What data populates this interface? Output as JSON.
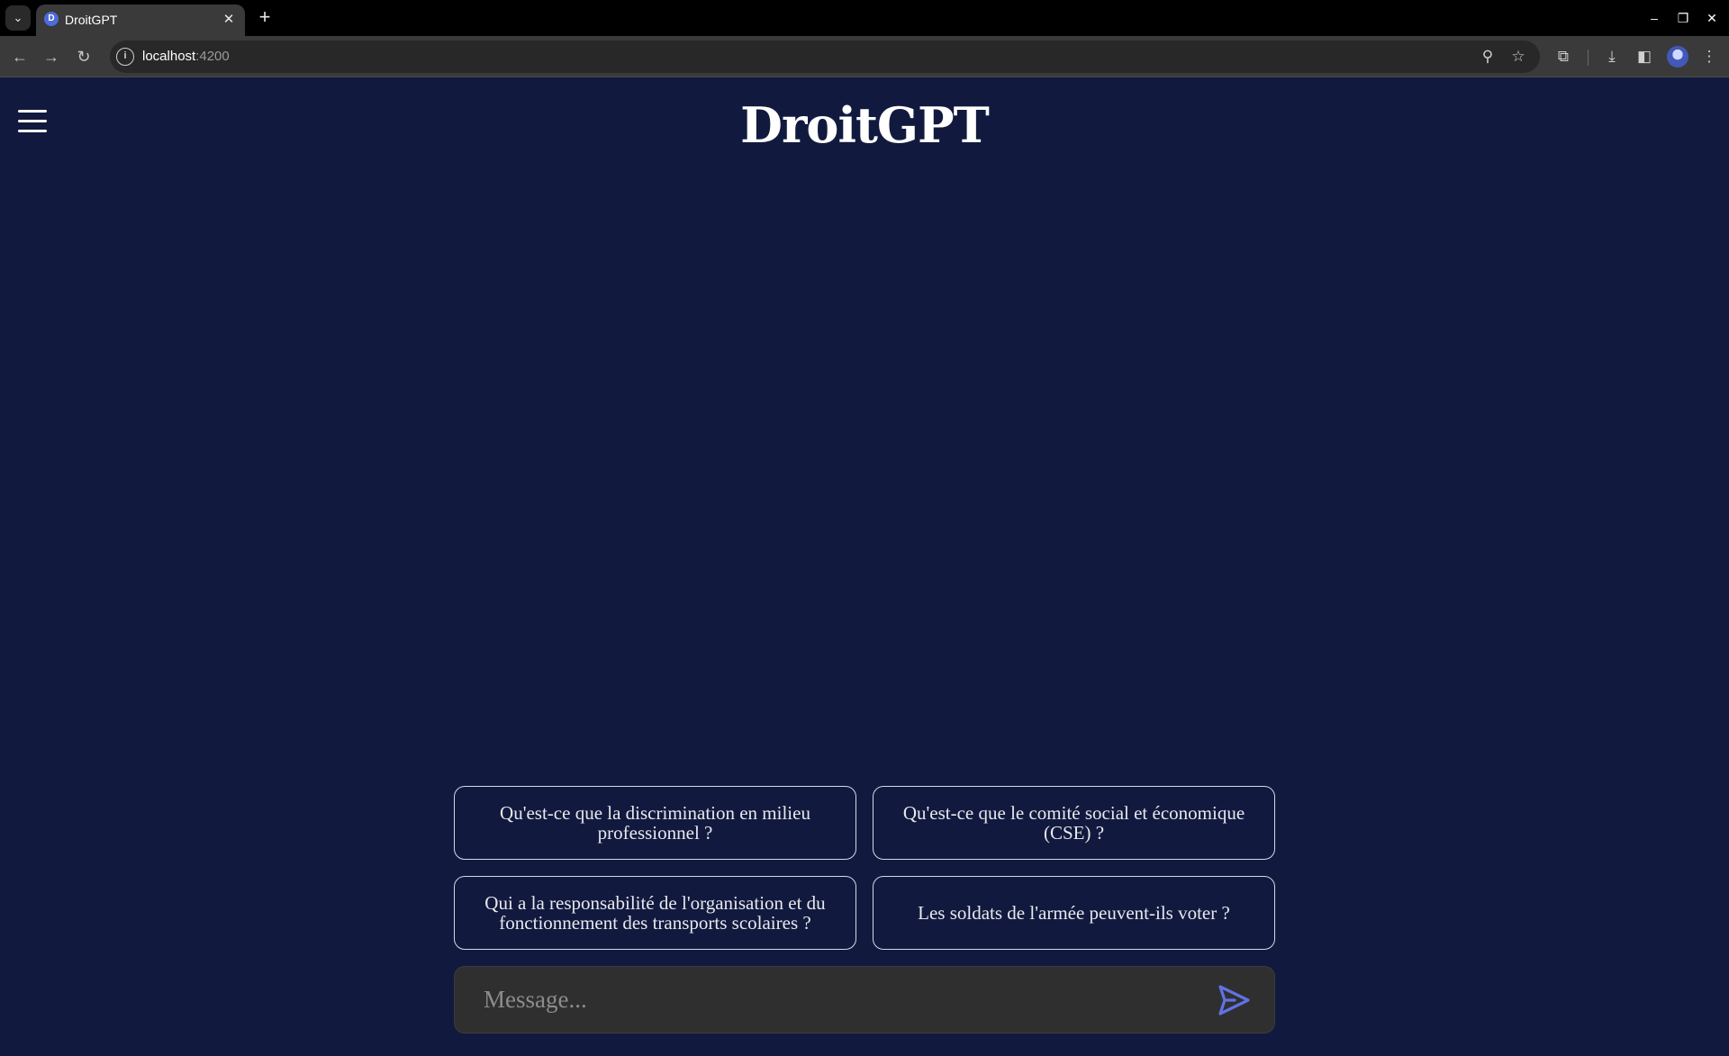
{
  "browser": {
    "tab": {
      "favicon_letter": "D",
      "title": "DroitGPT",
      "close": "✕"
    },
    "new_tab": "+",
    "tab_search": "⌄",
    "window_controls": {
      "minimize": "–",
      "restore": "❐",
      "close": "✕"
    },
    "nav": {
      "back": "←",
      "forward": "→",
      "reload": "↻"
    },
    "address": {
      "host": "localhost",
      "port": ":4200",
      "info_glyph": "i"
    },
    "icons": {
      "zoom": "⚲",
      "bookmark": "☆",
      "extensions": "⧉",
      "download": "⤓",
      "side_panel": "◧",
      "menu": "⋮"
    }
  },
  "app": {
    "title": "DroitGPT",
    "suggestions": [
      "Qu'est-ce que la discrimination en milieu professionnel ?",
      "Qu'est-ce que le comité social et économique (CSE) ?",
      "Qui a la responsabilité de l'organisation et du fonctionnement des transports scolaires ?",
      "Les soldats de l'armée peuvent-ils voter ?"
    ],
    "composer": {
      "placeholder": "Message...",
      "value": ""
    }
  },
  "colors": {
    "page_background": "#111a3e",
    "send_icon": "#5f72e6",
    "composer_background": "#2f2f2f"
  }
}
